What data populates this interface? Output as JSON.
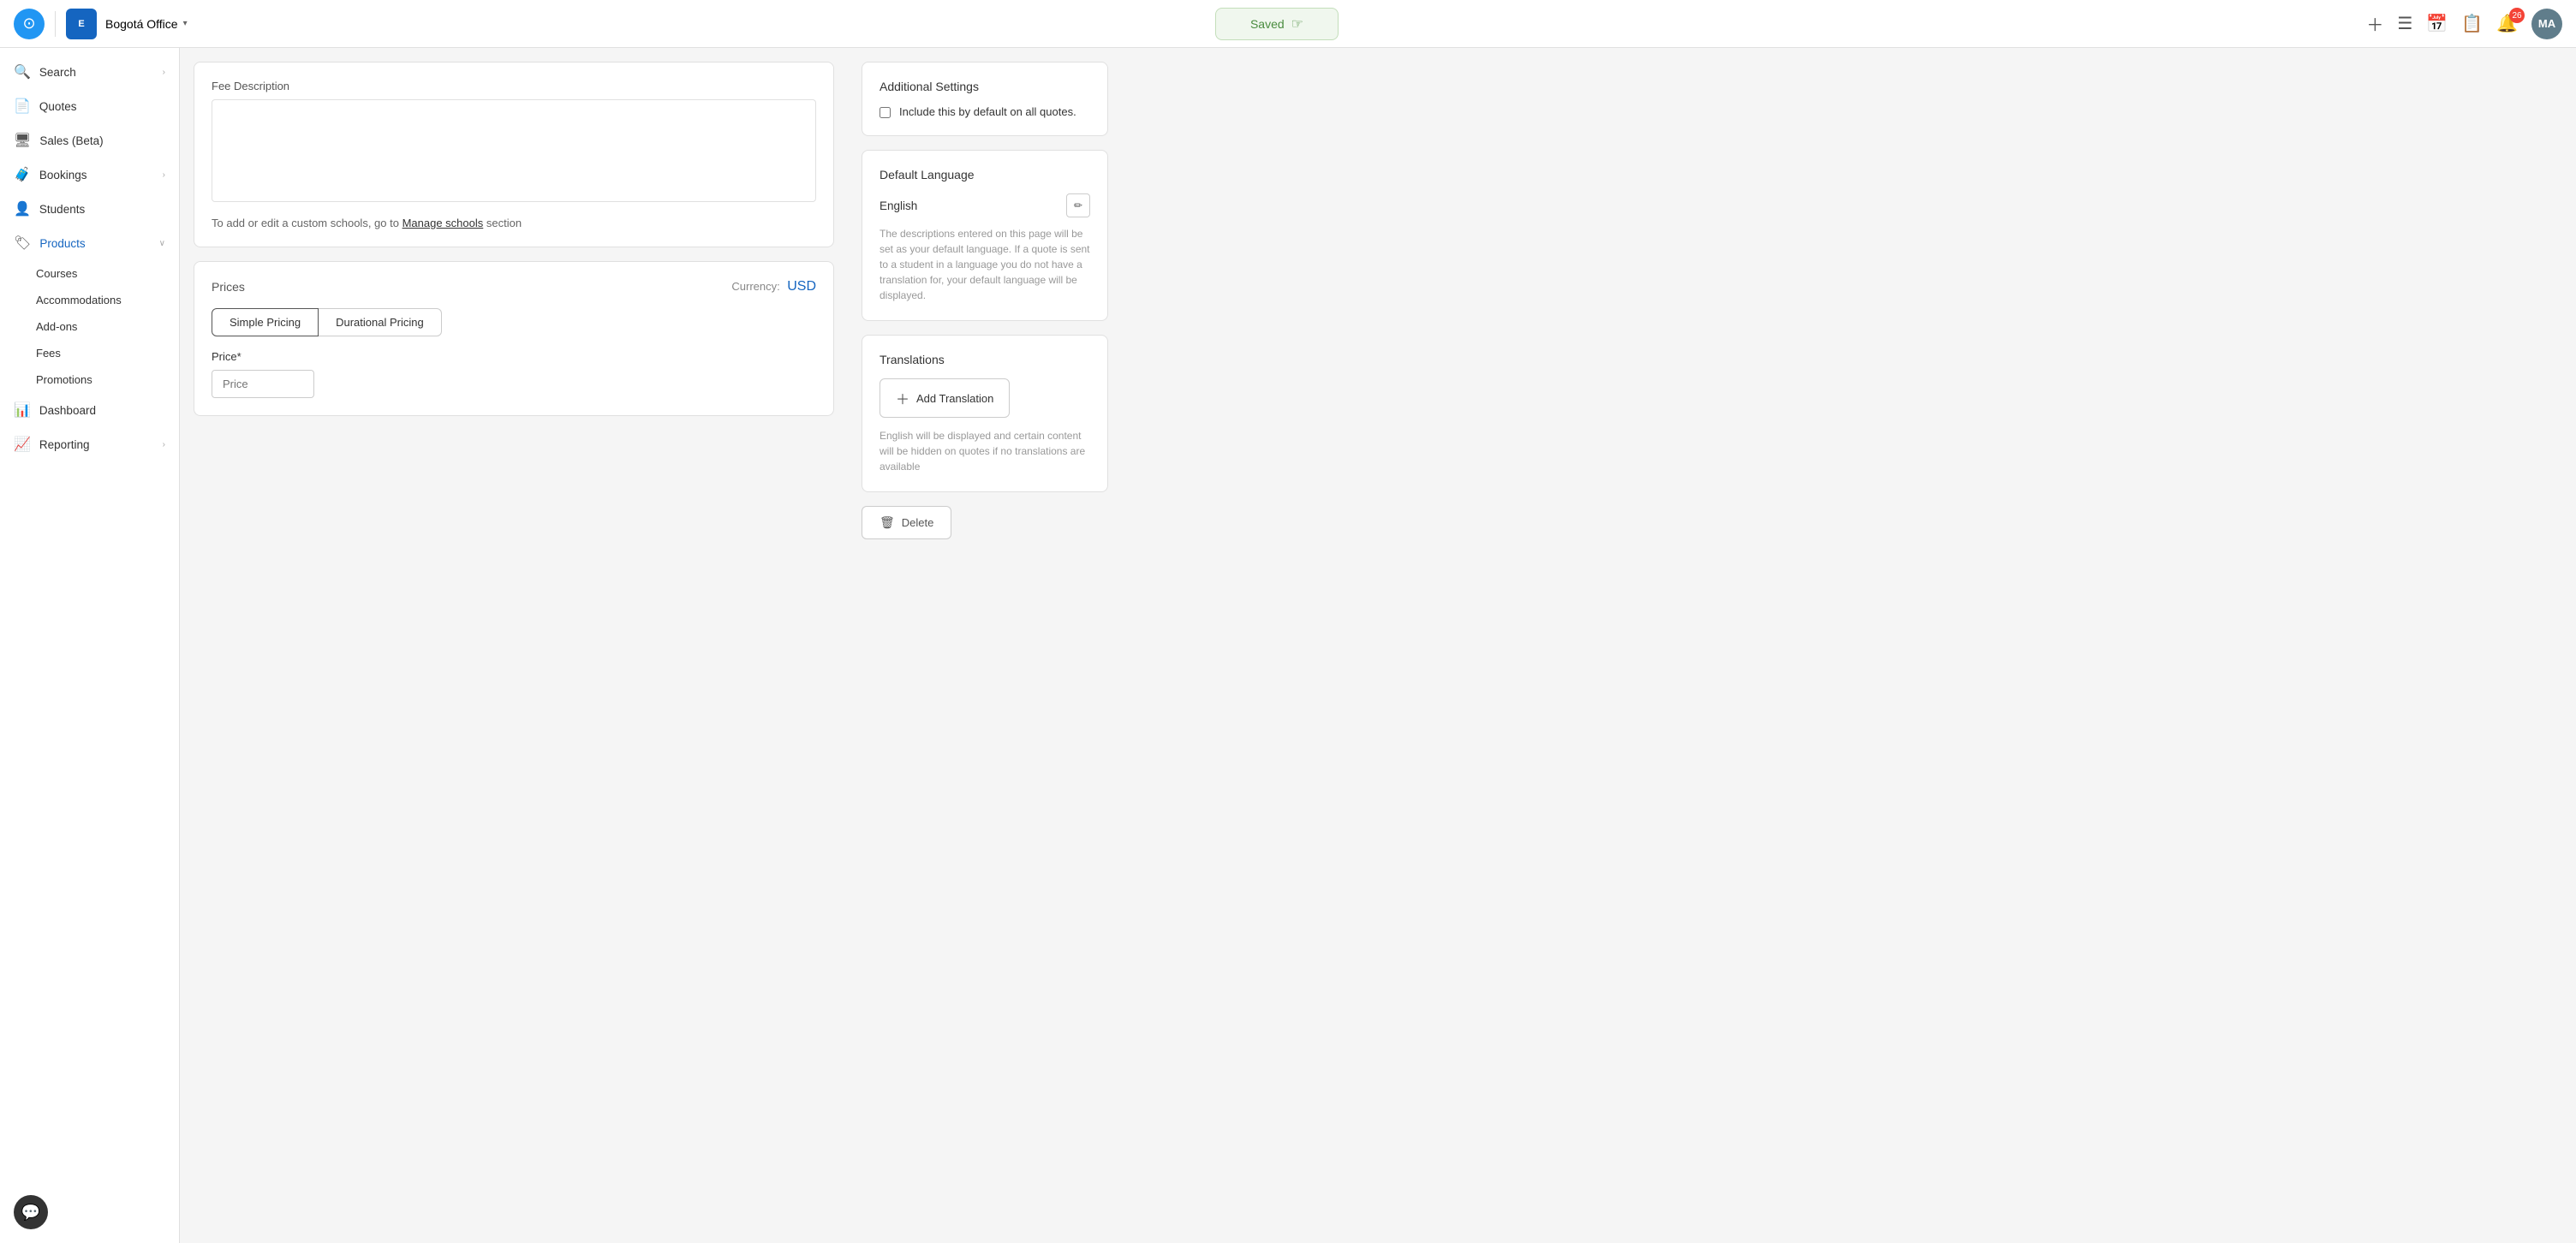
{
  "topnav": {
    "brand_letter": "E",
    "office": "Bogotá Office",
    "saved_label": "Saved",
    "user_initials": "MA",
    "notification_count": "26"
  },
  "sidebar": {
    "items": [
      {
        "id": "search",
        "label": "Search",
        "icon": "🔍",
        "chevron": true
      },
      {
        "id": "quotes",
        "label": "Quotes",
        "icon": "📄",
        "chevron": false
      },
      {
        "id": "sales",
        "label": "Sales (Beta)",
        "icon": "🖥",
        "chevron": false
      },
      {
        "id": "bookings",
        "label": "Bookings",
        "icon": "🧳",
        "chevron": true
      },
      {
        "id": "students",
        "label": "Students",
        "icon": "👤",
        "chevron": false
      },
      {
        "id": "products",
        "label": "Products",
        "icon": "🏷",
        "chevron": true,
        "expanded": true
      },
      {
        "id": "dashboard",
        "label": "Dashboard",
        "icon": "📊",
        "chevron": false
      },
      {
        "id": "reporting",
        "label": "Reporting",
        "icon": "📈",
        "chevron": true
      }
    ],
    "products_submenu": [
      {
        "id": "courses",
        "label": "Courses"
      },
      {
        "id": "accommodations",
        "label": "Accommodations"
      },
      {
        "id": "addons",
        "label": "Add-ons"
      },
      {
        "id": "fees",
        "label": "Fees"
      },
      {
        "id": "promotions",
        "label": "Promotions"
      }
    ]
  },
  "main": {
    "fee_description": {
      "label": "Fee Description",
      "placeholder": ""
    },
    "manage_schools_text": "To add or edit a custom schools, go to",
    "manage_schools_link": "Manage schools",
    "manage_schools_suffix": "section",
    "prices": {
      "title": "Prices",
      "currency_label": "Currency:",
      "currency_value": "USD",
      "tabs": [
        {
          "id": "simple",
          "label": "Simple Pricing",
          "active": true
        },
        {
          "id": "durational",
          "label": "Durational Pricing",
          "active": false
        }
      ],
      "price_label": "Price*",
      "price_placeholder": "Price"
    }
  },
  "right_panel": {
    "additional_settings": {
      "title": "Additional Settings",
      "checkbox_label": "Include this by default on all quotes."
    },
    "default_language": {
      "title": "Default Language",
      "value": "English",
      "description": "The descriptions entered on this page will be set as your default language. If a quote is sent to a student in a language you do not have a translation for, your default language will be displayed."
    },
    "translations": {
      "title": "Translations",
      "add_label": "Add Translation",
      "note": "English will be displayed and certain content will be hidden on quotes if no translations are available"
    },
    "delete": {
      "label": "Delete"
    }
  },
  "chat": {
    "icon": "💬"
  }
}
